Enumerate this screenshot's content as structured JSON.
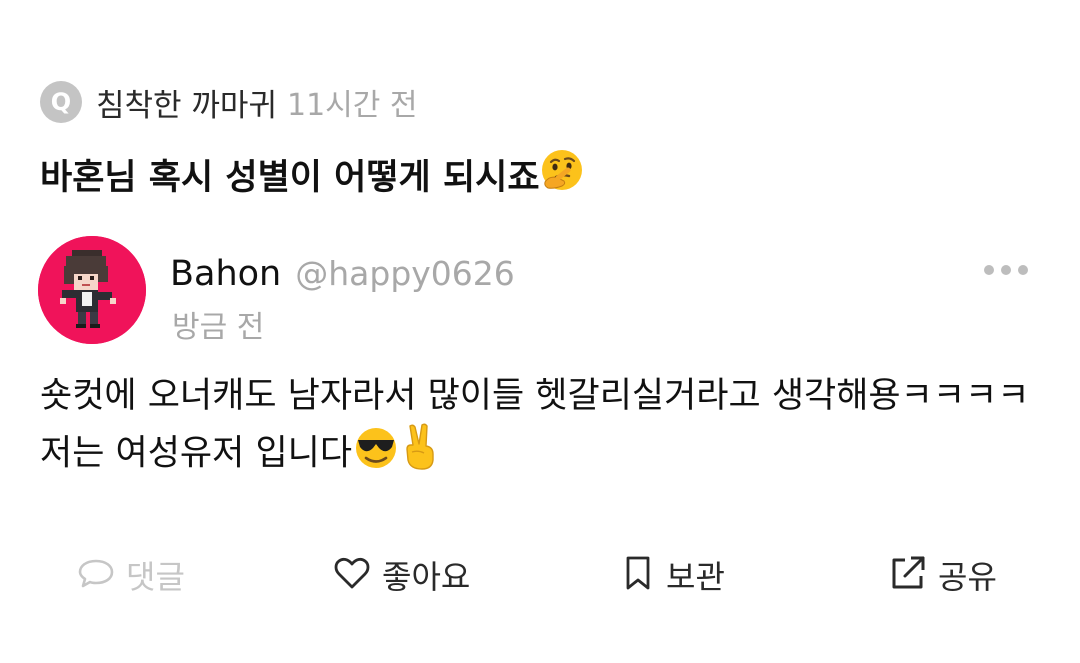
{
  "question": {
    "badge": "Q",
    "asker": "침착한 까마귀",
    "time": "11시간 전",
    "text": "바혼님 혹시 성별이 어떻게 되시죠",
    "emoji_icon": "thinking-face-icon"
  },
  "answer": {
    "author_name": "Bahon",
    "author_handle": "@happy0626",
    "time": "방금 전",
    "text": "숏컷에 오너캐도 남자라서 많이들 헷갈리실거라고 생각해용ㅋㅋㅋㅋ 저는 여성유저 입니다",
    "emoji_icons": [
      "sunglasses-face-icon",
      "victory-hand-icon"
    ],
    "avatar_color": "#f0135a"
  },
  "actions": {
    "comment": "댓글",
    "like": "좋아요",
    "save": "보관",
    "share": "공유"
  },
  "colors": {
    "muted": "#a8a8a8",
    "disabled": "#c6c6c6",
    "text": "#111111"
  }
}
